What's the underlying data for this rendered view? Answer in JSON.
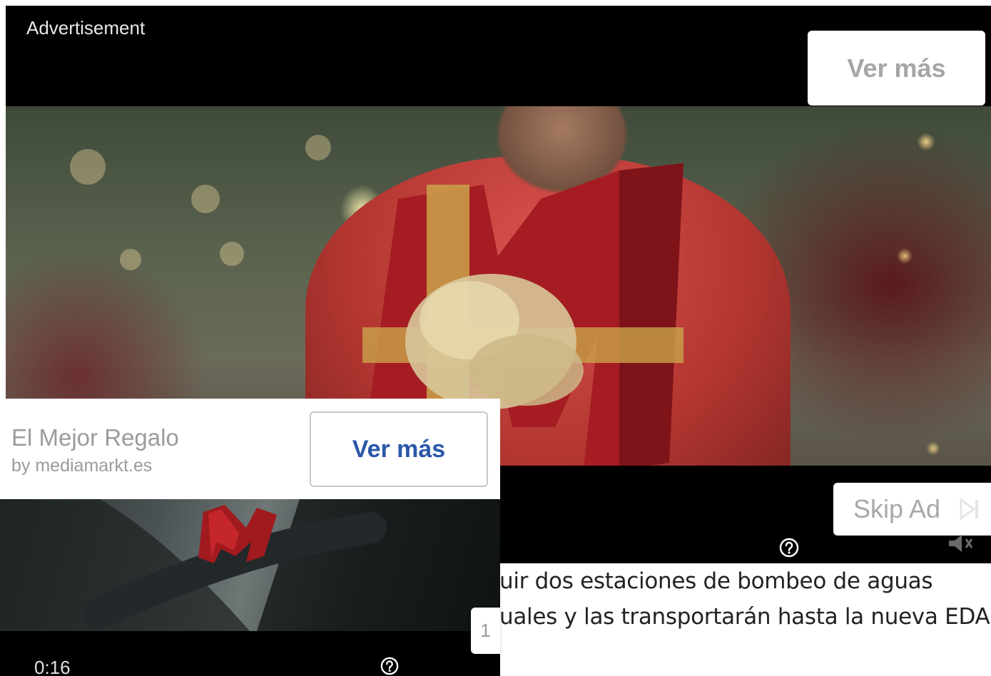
{
  "main_ad": {
    "label": "Advertisement",
    "cta_label": "Ver más",
    "skip_label": "Skip Ad",
    "help_icon": "question-circle-icon",
    "skip_icon": "skip-next-icon",
    "volume_icon": "volume-icon"
  },
  "article": {
    "lines": [
      "uir dos estaciones de bombeo de aguas",
      "uales y las transportarán hasta la nueva EDAR, y"
    ]
  },
  "mini_player": {
    "title": "El Mejor Regalo",
    "by": "by mediamarkt.es",
    "cta_label": "Ver más",
    "timer": "0:16",
    "help_icon": "question-circle-icon"
  },
  "page_badge": "1",
  "colors": {
    "cta_blue": "#2b57a8",
    "muted_gray": "#9b9b9b",
    "video_black": "#000000",
    "gift_red": "#a51c22"
  }
}
